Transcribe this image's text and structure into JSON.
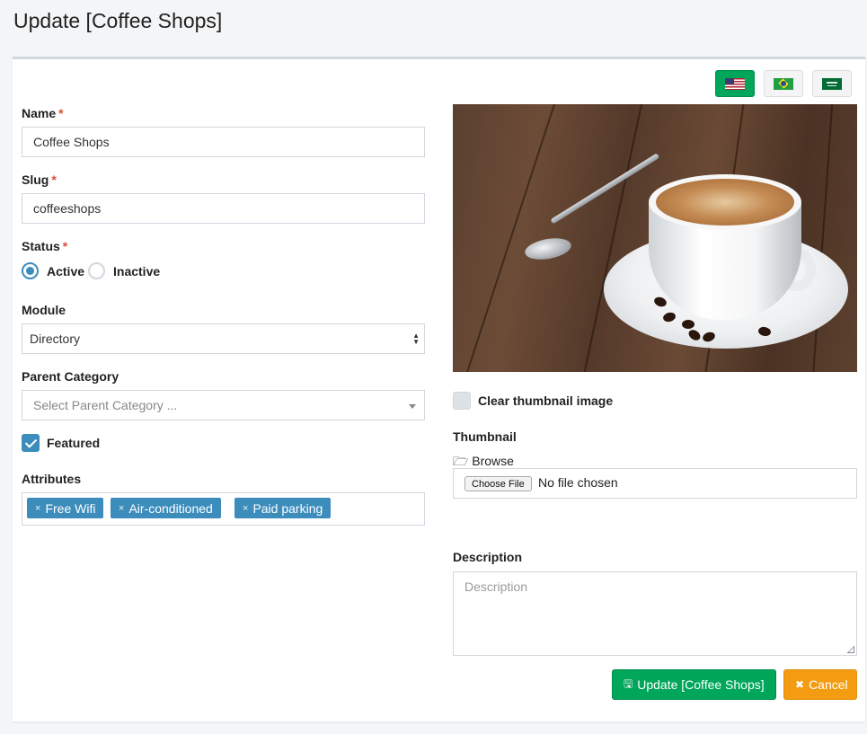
{
  "page": {
    "title": "Update [Coffee Shops]"
  },
  "languages": [
    {
      "code": "en-US",
      "icon": "flag-us-icon",
      "active": true
    },
    {
      "code": "pt-BR",
      "icon": "flag-br-icon",
      "active": false
    },
    {
      "code": "ar-SA",
      "icon": "flag-sa-icon",
      "active": false
    }
  ],
  "form": {
    "name": {
      "label": "Name",
      "required_mark": "*",
      "value": "Coffee Shops"
    },
    "slug": {
      "label": "Slug",
      "required_mark": "*",
      "value": "coffeeshops"
    },
    "status": {
      "label": "Status",
      "required_mark": "*",
      "options": [
        "Active",
        "Inactive"
      ],
      "selected": "Active"
    },
    "module": {
      "label": "Module",
      "value": "Directory"
    },
    "parent_category": {
      "label": "Parent Category",
      "placeholder": "Select Parent Category ..."
    },
    "featured": {
      "label": "Featured",
      "checked": true
    },
    "attributes": {
      "label": "Attributes",
      "remove_glyph": "×",
      "tags": [
        "Free Wifi",
        "Air-conditioned",
        "Paid parking"
      ]
    },
    "clear_thumbnail": {
      "label": "Clear thumbnail image",
      "checked": false
    },
    "thumbnail": {
      "label": "Thumbnail",
      "browse_label": "Browse",
      "choose_button": "Choose File",
      "file_status": "No file chosen"
    },
    "description": {
      "label": "Description",
      "placeholder": "Description",
      "value": ""
    }
  },
  "actions": {
    "update_label": "Update [Coffee Shops]",
    "cancel_label": "Cancel"
  },
  "colors": {
    "primary": "#3c8dbc",
    "success": "#00a65a",
    "warning": "#f39c12",
    "required": "#dd4b39"
  }
}
